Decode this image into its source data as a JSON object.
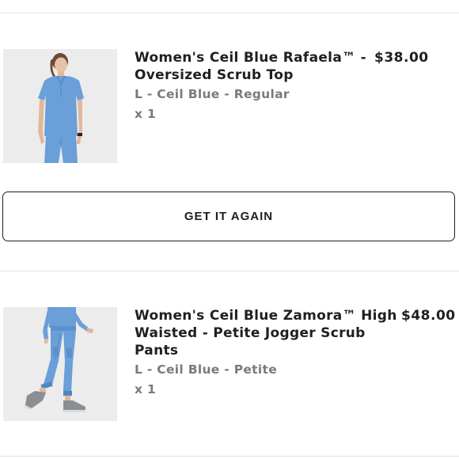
{
  "order_items": [
    {
      "title_line1": "Women's Ceil Blue Rafaela™ -",
      "title_line2": "Oversized Scrub Top",
      "variant": "L - Ceil Blue - Regular",
      "quantity": "x 1",
      "price": "$38.00",
      "image": "model-wearing-ceil-blue-scrub-top"
    },
    {
      "title_line1": "Women's Ceil Blue Zamora™ High",
      "title_line2": "Waisted - Petite Jogger Scrub",
      "title_line3": "Pants",
      "variant": "L - Ceil Blue - Petite",
      "quantity": "x 1",
      "price": "$48.00",
      "image": "model-wearing-ceil-blue-jogger-pants"
    }
  ],
  "actions": {
    "get_it_again_label": "GET IT AGAIN"
  },
  "colors": {
    "ceil_blue": "#6a9fd8",
    "text_primary": "#1f1f1f",
    "text_secondary": "#7a7a7a",
    "divider": "#e3e3e3"
  }
}
